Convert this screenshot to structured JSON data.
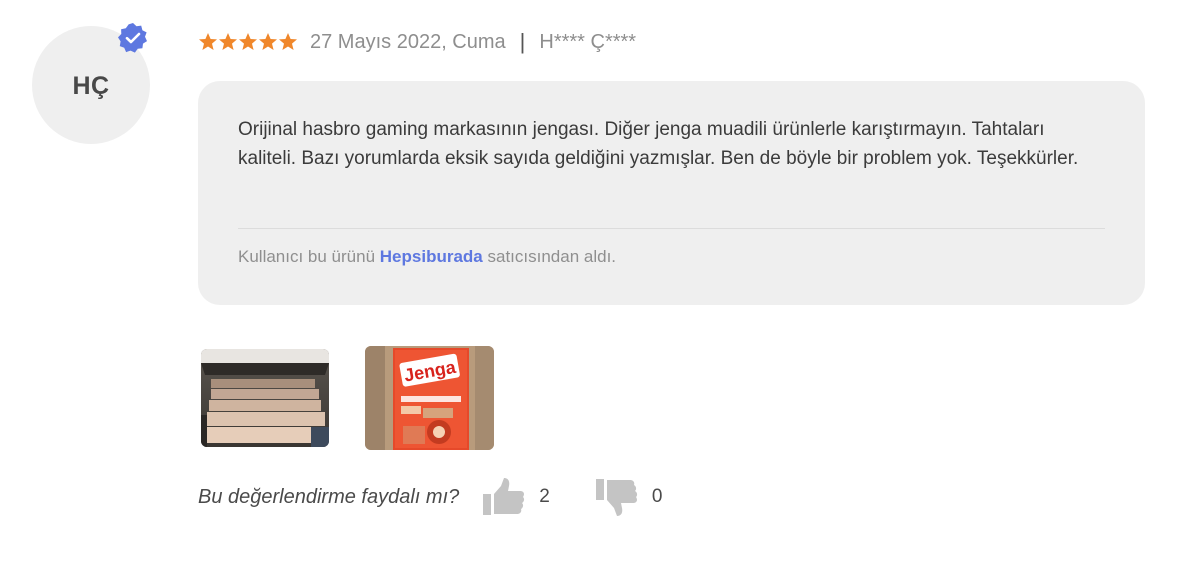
{
  "user": {
    "initials": "HÇ",
    "verified_icon": "verified-check-icon",
    "name": "H**** Ç****"
  },
  "rating": {
    "stars": 5,
    "max": 5,
    "icon": "star-icon",
    "color": "#f0872b"
  },
  "date": "27 Mayıs 2022, Cuma",
  "separator": "|",
  "review": {
    "text": "Orijinal hasbro gaming markasının jengası. Diğer jenga muadili ürünlerle karıştırmayın. Tahtaları kaliteli. Bazı yorumlarda eksik sayıda geldiğini yazmışlar. Ben de böyle bir problem yok. Teşekkürler.",
    "seller_prefix": "Kullanıcı bu ürünü",
    "seller_name": "Hepsiburada",
    "seller_suffix": "satıcısından aldı."
  },
  "photos": [
    {
      "alt": "Jenga blocks in box"
    },
    {
      "alt": "Jenga box",
      "box_label": "Jenga"
    }
  ],
  "helpful": {
    "question": "Bu değerlendirme faydalı mı?",
    "up_count": "2",
    "down_count": "0",
    "up_icon": "thumbs-up-icon",
    "down_icon": "thumbs-down-icon"
  },
  "colors": {
    "accent": "#5e78e0",
    "star": "#f0872b",
    "box_bg": "#efefef"
  }
}
